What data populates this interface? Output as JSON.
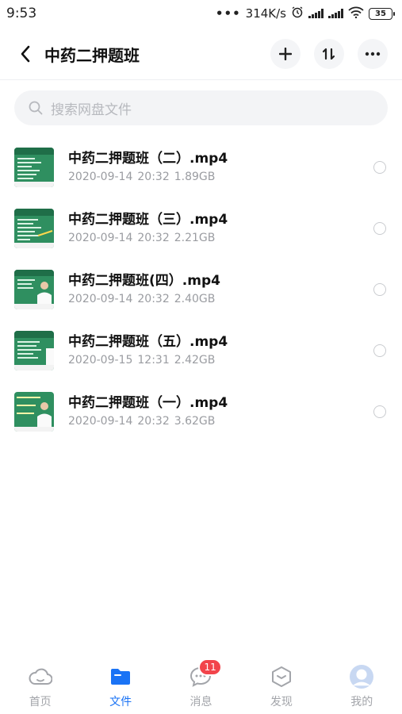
{
  "status_bar": {
    "time": "9:53",
    "dots": "•••",
    "speed": "314K/s",
    "battery": "35"
  },
  "header": {
    "title": "中药二押题班"
  },
  "search": {
    "placeholder": "搜索网盘文件"
  },
  "files": [
    {
      "name": "中药二押题班（二）.mp4",
      "date": "2020-09-14",
      "time": "20:32",
      "size": "1.89GB"
    },
    {
      "name": "中药二押题班（三）.mp4",
      "date": "2020-09-14",
      "time": "20:32",
      "size": "2.21GB"
    },
    {
      "name": "中药二押题班(四）.mp4",
      "date": "2020-09-14",
      "time": "20:32",
      "size": "2.40GB"
    },
    {
      "name": "中药二押题班（五）.mp4",
      "date": "2020-09-15",
      "time": "12:31",
      "size": "2.42GB"
    },
    {
      "name": "中药二押题班（一）.mp4",
      "date": "2020-09-14",
      "time": "20:32",
      "size": "3.62GB"
    }
  ],
  "nav": {
    "home": "首页",
    "files": "文件",
    "messages": "消息",
    "messages_badge": "11",
    "discover": "发现",
    "mine": "我的"
  },
  "colors": {
    "accent": "#1a73f5",
    "badge": "#f2444b",
    "thumbnail_green": "#2f8f60"
  }
}
